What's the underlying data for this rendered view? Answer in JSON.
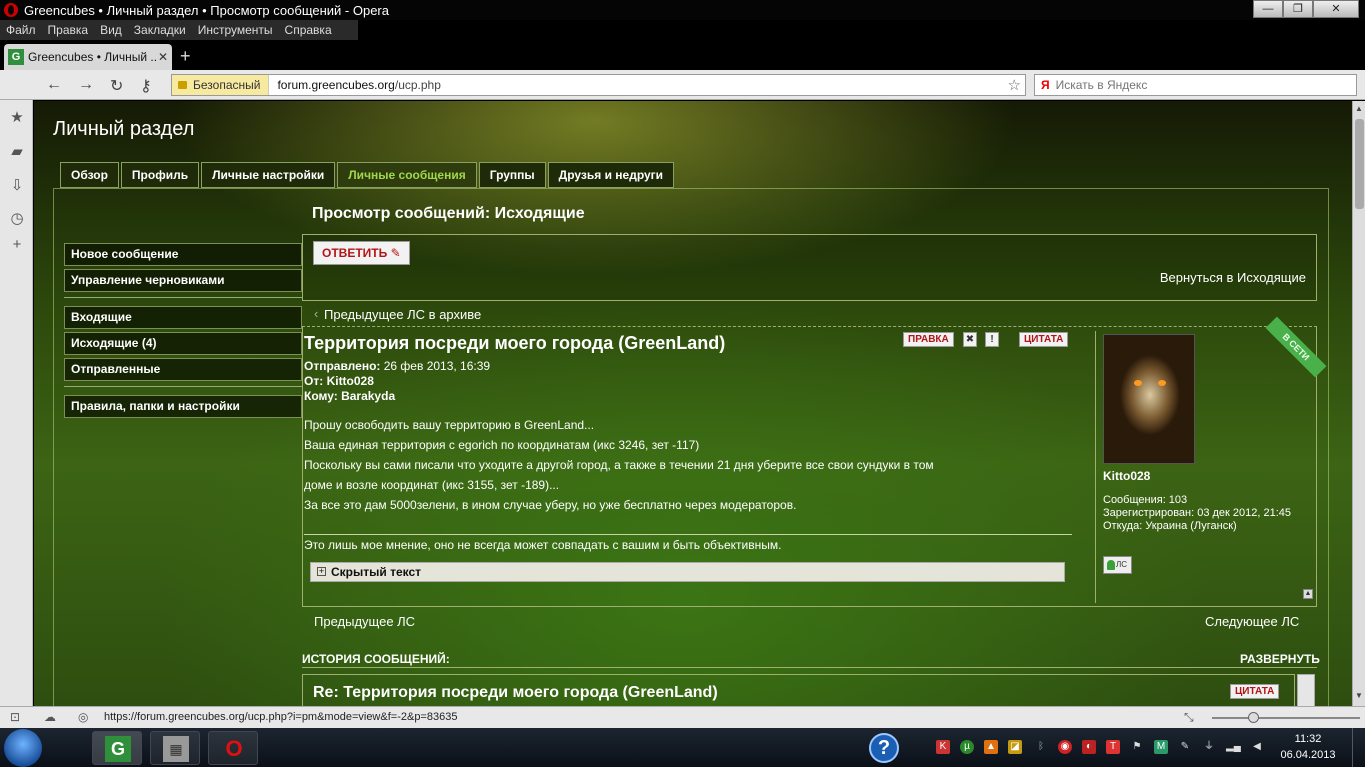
{
  "window": {
    "title": "Greencubes • Личный раздел • Просмотр сообщений - Opera",
    "buttons": {
      "minimize": "—",
      "maximize": "❐",
      "close": "✕"
    }
  },
  "menubar": [
    "Файл",
    "Правка",
    "Вид",
    "Закладки",
    "Инструменты",
    "Справка"
  ],
  "browser_tab": {
    "title": "Greencubes • Личный ...",
    "favicon_letter": "G",
    "close": "✕",
    "new_tab": "+"
  },
  "address": {
    "secure_label": "Безопасный",
    "url_host": "forum.greencubes.org",
    "url_path": "/ucp.php",
    "search_placeholder": "Искать в Яндекс",
    "search_engine_letter": "Я"
  },
  "page": {
    "title": "Личный раздел",
    "tabs": [
      {
        "label": "Обзор",
        "active": false
      },
      {
        "label": "Профиль",
        "active": false
      },
      {
        "label": "Личные настройки",
        "active": false
      },
      {
        "label": "Личные сообщения",
        "active": true
      },
      {
        "label": "Группы",
        "active": false
      },
      {
        "label": "Друзья и недруги",
        "active": false
      }
    ],
    "left_menu": {
      "group1": [
        "Новое сообщение",
        "Управление черновиками"
      ],
      "group2": [
        "Входящие",
        "Исходящие (4)",
        "Отправленные"
      ],
      "group3": [
        "Правила, папки и настройки"
      ]
    },
    "section_title": "Просмотр сообщений: Исходящие",
    "reply_button": "ОТВЕТИТЬ",
    "back_link": "Вернуться в Исходящие",
    "prev_archive": "Предыдущее ЛС в архиве",
    "post": {
      "title": "Территория посреди моего города (GreenLand)",
      "buttons": {
        "edit": "ПРАВКА",
        "delete": "✖",
        "warn": "!",
        "quote": "ЦИТАТА"
      },
      "sent_label": "Отправлено:",
      "sent_value": "26 фев 2013, 16:39",
      "from_label": "От:",
      "from_value": "Kitto028",
      "to_label": "Кому:",
      "to_value": "Barakyda",
      "body_lines": [
        "Прошу освободить вашу территорию в GreenLand...",
        "Ваша единая территория с egorich по координатам (икс 3246, зет -117)",
        "Поскольку вы сами писали что уходите а другой город, а также в течении 21 дня уберите все свои сундуки в том",
        "доме и возле координат (икс 3155, зет -189)...",
        "За все это дам 5000зелени, в ином случае уберу, но уже бесплатно через модераторов."
      ],
      "signature": "Это лишь мое мнение, оно не всегда может совпадать с вашим и быть объективным.",
      "spoiler_label": "Скрытый текст",
      "spoiler_toggle": "+"
    },
    "profile": {
      "online_badge": "В СЕТИ",
      "username": "Kitto028",
      "messages": "Сообщения: 103",
      "registered": "Зарегистрирован: 03 дек 2012, 21:45",
      "location": "Откуда: Украина (Луганск)",
      "pm_label": "ЛС"
    },
    "prev_pm": "Предыдущее ЛС",
    "next_pm": "Следующее ЛС",
    "history_title": "ИСТОРИЯ СООБЩЕНИЙ:",
    "expand_label": "РАЗВЕРНУТЬ",
    "history_post_title": "Re: Территория посреди моего города (GreenLand)",
    "history_quote": "ЦИТАТА"
  },
  "statusbar": {
    "url": "https://forum.greencubes.org/ucp.php?i=pm&mode=view&f=-2&p=83635"
  },
  "taskbar": {
    "clock_time": "11:32",
    "clock_date": "06.04.2013",
    "help": "?",
    "app_letter": "G"
  },
  "colors": {
    "accent_green": "#9fd84a",
    "button_red": "#b0151a",
    "online_green": "#4ab04a"
  }
}
